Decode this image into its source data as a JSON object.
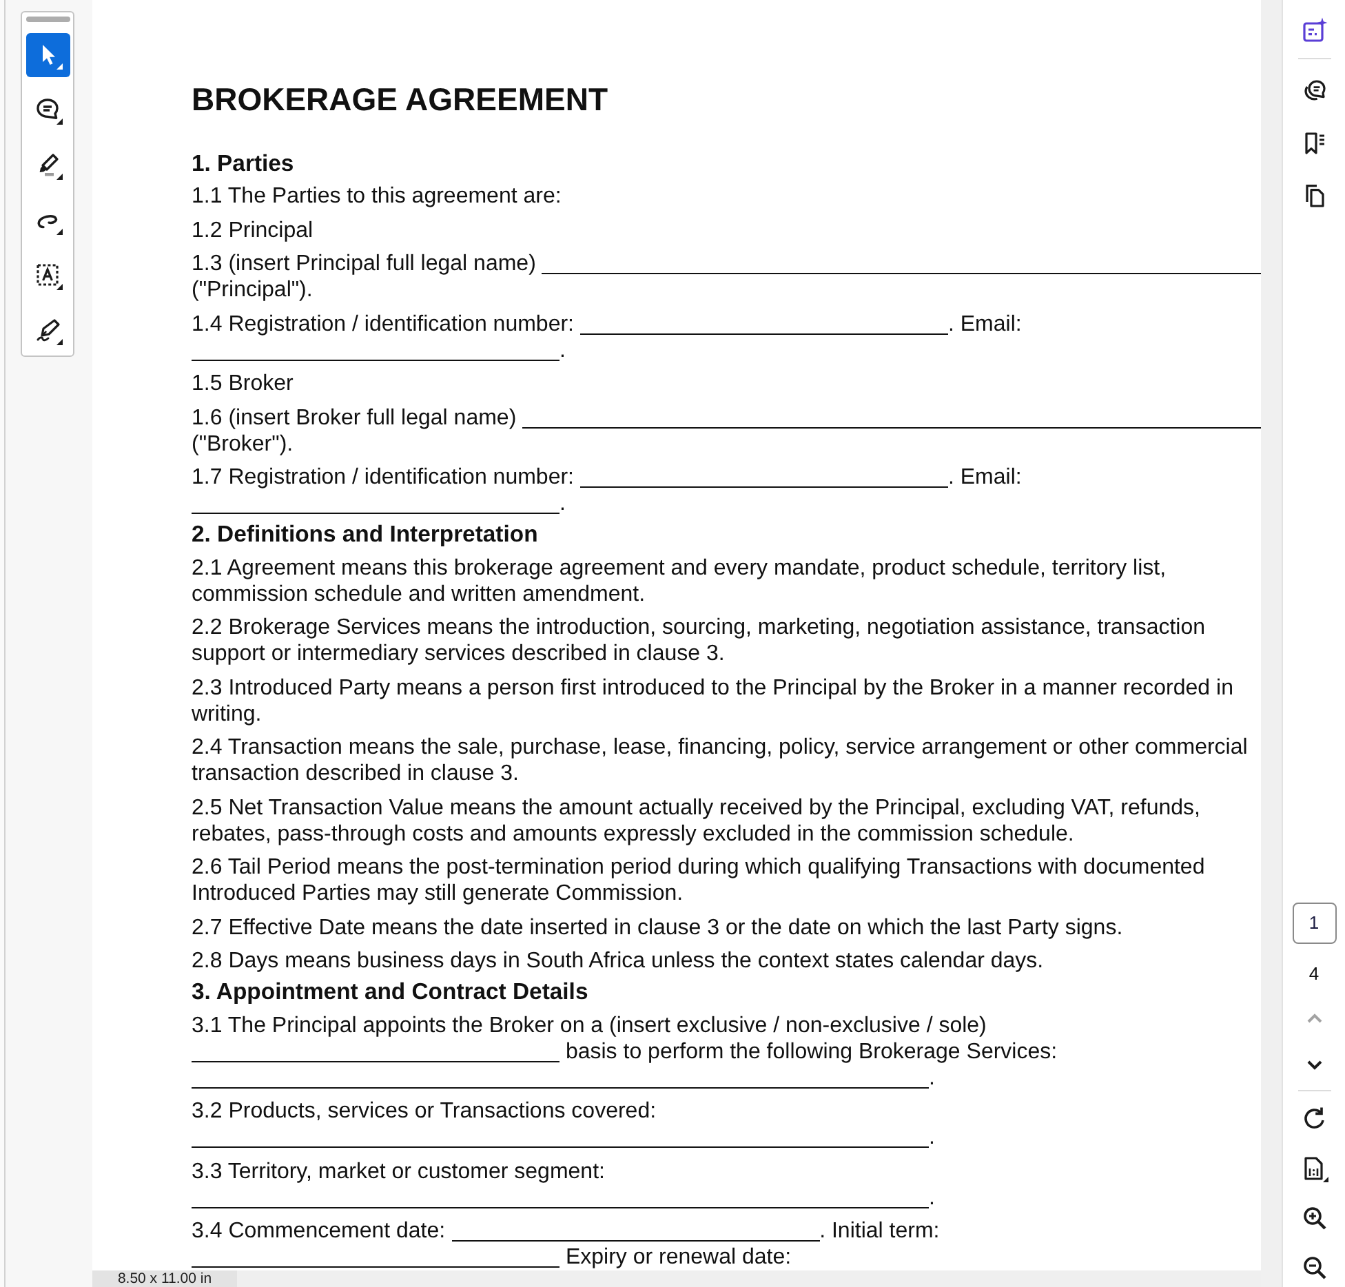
{
  "left_toolbar": {
    "tools": [
      {
        "kind": "select",
        "selected": true
      },
      {
        "kind": "comment",
        "selected": false
      },
      {
        "kind": "highlight",
        "selected": false
      },
      {
        "kind": "draw",
        "selected": false
      },
      {
        "kind": "text_select",
        "selected": false
      },
      {
        "kind": "sign",
        "selected": false
      }
    ]
  },
  "document": {
    "title": "BROKERAGE AGREEMENT",
    "sections": [
      {
        "heading": "1. Parties",
        "clauses": [
          {
            "parts": [
              {
                "kind": "text",
                "text": "1.1 The Parties to this agreement are:"
              }
            ]
          },
          {
            "parts": [
              {
                "kind": "text",
                "text": "1.2 Principal"
              }
            ]
          },
          {
            "parts": [
              {
                "kind": "text",
                "text": "1.3 (insert Principal full legal name)"
              },
              {
                "kind": "fill_blank"
              },
              {
                "kind": "text",
                "text": "(\"Principal\")."
              }
            ]
          },
          {
            "parts": [
              {
                "kind": "text",
                "text": "1.4 Registration / identification number:"
              },
              {
                "kind": "blank"
              },
              {
                "kind": "text",
                "text": ". Email:"
              },
              {
                "kind": "blank"
              },
              {
                "kind": "text",
                "text": "."
              }
            ]
          },
          {
            "parts": [
              {
                "kind": "text",
                "text": "1.5 Broker"
              }
            ]
          },
          {
            "parts": [
              {
                "kind": "text",
                "text": "1.6 (insert Broker full legal name)"
              },
              {
                "kind": "fill_blank"
              },
              {
                "kind": "text",
                "text": "(\"Broker\")."
              }
            ]
          },
          {
            "parts": [
              {
                "kind": "text",
                "text": "1.7 Registration / identification number:"
              },
              {
                "kind": "blank"
              },
              {
                "kind": "text",
                "text": ". Email:"
              },
              {
                "kind": "blank"
              },
              {
                "kind": "text",
                "text": "."
              }
            ]
          }
        ]
      },
      {
        "heading": "2. Definitions and Interpretation",
        "clauses": [
          {
            "parts": [
              {
                "kind": "text",
                "text": "2.1 Agreement means this brokerage agreement and every mandate, product schedule, territory list, commission schedule and written amendment."
              }
            ]
          },
          {
            "parts": [
              {
                "kind": "text",
                "text": "2.2 Brokerage Services means the introduction, sourcing, marketing, negotiation assistance, transaction support or intermediary services described in clause 3."
              }
            ]
          },
          {
            "parts": [
              {
                "kind": "text",
                "text": "2.3 Introduced Party means a person first introduced to the Principal by the Broker in a manner recorded in writing."
              }
            ]
          },
          {
            "parts": [
              {
                "kind": "text",
                "text": "2.4 Transaction means the sale, purchase, lease, financing, policy, service arrangement or other commercial transaction described in clause 3."
              }
            ]
          },
          {
            "parts": [
              {
                "kind": "text",
                "text": "2.5 Net Transaction Value means the amount actually received by the Principal, excluding VAT, refunds, rebates, pass-through costs and amounts expressly excluded in the commission schedule."
              }
            ]
          },
          {
            "parts": [
              {
                "kind": "text",
                "text": "2.6 Tail Period means the post-termination period during which qualifying Transactions with documented Introduced Parties may still generate Commission."
              }
            ]
          },
          {
            "parts": [
              {
                "kind": "text",
                "text": "2.7 Effective Date means the date inserted in clause 3 or the date on which the last Party signs."
              }
            ]
          },
          {
            "parts": [
              {
                "kind": "text",
                "text": "2.8 Days means business days in South Africa unless the context states calendar days."
              }
            ]
          }
        ]
      },
      {
        "heading": "3. Appointment and Contract Details",
        "clauses": [
          {
            "parts": [
              {
                "kind": "text",
                "text": "3.1 The Principal appoints the Broker on a (insert exclusive / non-exclusive / sole)"
              },
              {
                "kind": "blank"
              },
              {
                "kind": "text",
                "text": " basis to perform the following Brokerage Services:"
              },
              {
                "kind": "long_blank"
              },
              {
                "kind": "text",
                "text": "."
              }
            ]
          },
          {
            "parts": [
              {
                "kind": "text",
                "text": "3.2 Products, services or Transactions covered:"
              },
              {
                "kind": "long_blank"
              },
              {
                "kind": "text",
                "text": "."
              }
            ]
          },
          {
            "parts": [
              {
                "kind": "text",
                "text": "3.3 Territory, market or customer segment:"
              },
              {
                "kind": "long_blank"
              },
              {
                "kind": "text",
                "text": "."
              }
            ]
          },
          {
            "parts": [
              {
                "kind": "text",
                "text": "3.4 Commencement date:"
              },
              {
                "kind": "blank"
              },
              {
                "kind": "text",
                "text": ". Initial term:"
              },
              {
                "kind": "blank"
              },
              {
                "kind": "text",
                "text": " Expiry or renewal date:"
              }
            ]
          }
        ]
      }
    ]
  },
  "status_bar": {
    "page_size": "8.50 x 11.00 in"
  },
  "right_toolbar": {
    "panels": [
      {
        "kind": "assistant"
      },
      {
        "kind": "comments"
      },
      {
        "kind": "bookmarks"
      },
      {
        "kind": "pages"
      }
    ],
    "page_number": "1",
    "page_count": "4",
    "navigation": [
      {
        "kind": "previous_page",
        "disabled": true
      },
      {
        "kind": "next_page",
        "disabled": false
      }
    ],
    "view_tools": [
      {
        "kind": "rotate"
      },
      {
        "kind": "fit_page"
      },
      {
        "kind": "zoom_in"
      },
      {
        "kind": "zoom_out"
      }
    ]
  }
}
